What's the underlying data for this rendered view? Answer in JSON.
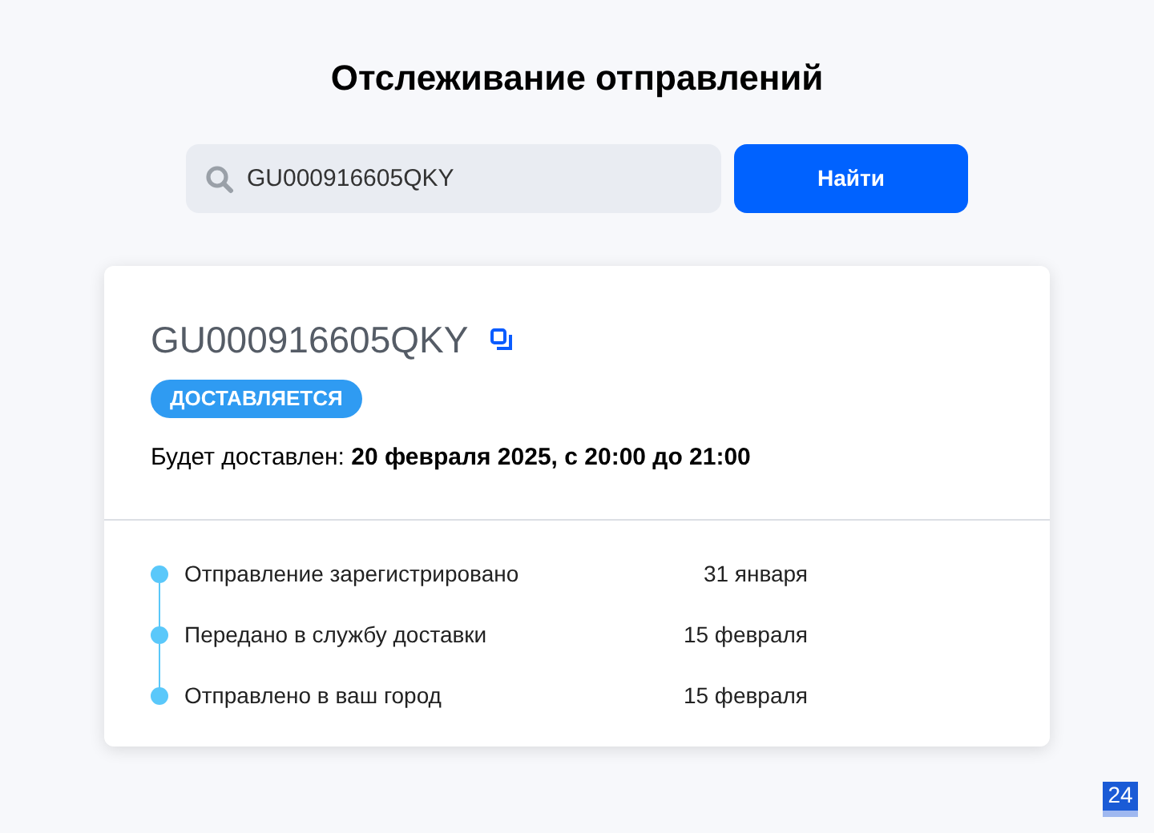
{
  "title": "Отслеживание отправлений",
  "search": {
    "value": "GU000916605QKY",
    "button": "Найти"
  },
  "shipment": {
    "number": "GU000916605QKY",
    "status": "ДОСТАВЛЯЕТСЯ",
    "delivery_label": "Будет доставлен:",
    "delivery_time": "20 февраля 2025, с 20:00 до 21:00",
    "events": [
      {
        "text": "Отправление зарегистрировано",
        "date": "31 января"
      },
      {
        "text": "Передано в службу доставки",
        "date": "15 февраля"
      },
      {
        "text": "Отправлено в ваш город",
        "date": "15 февраля"
      }
    ]
  },
  "widget": {
    "label": "24"
  }
}
